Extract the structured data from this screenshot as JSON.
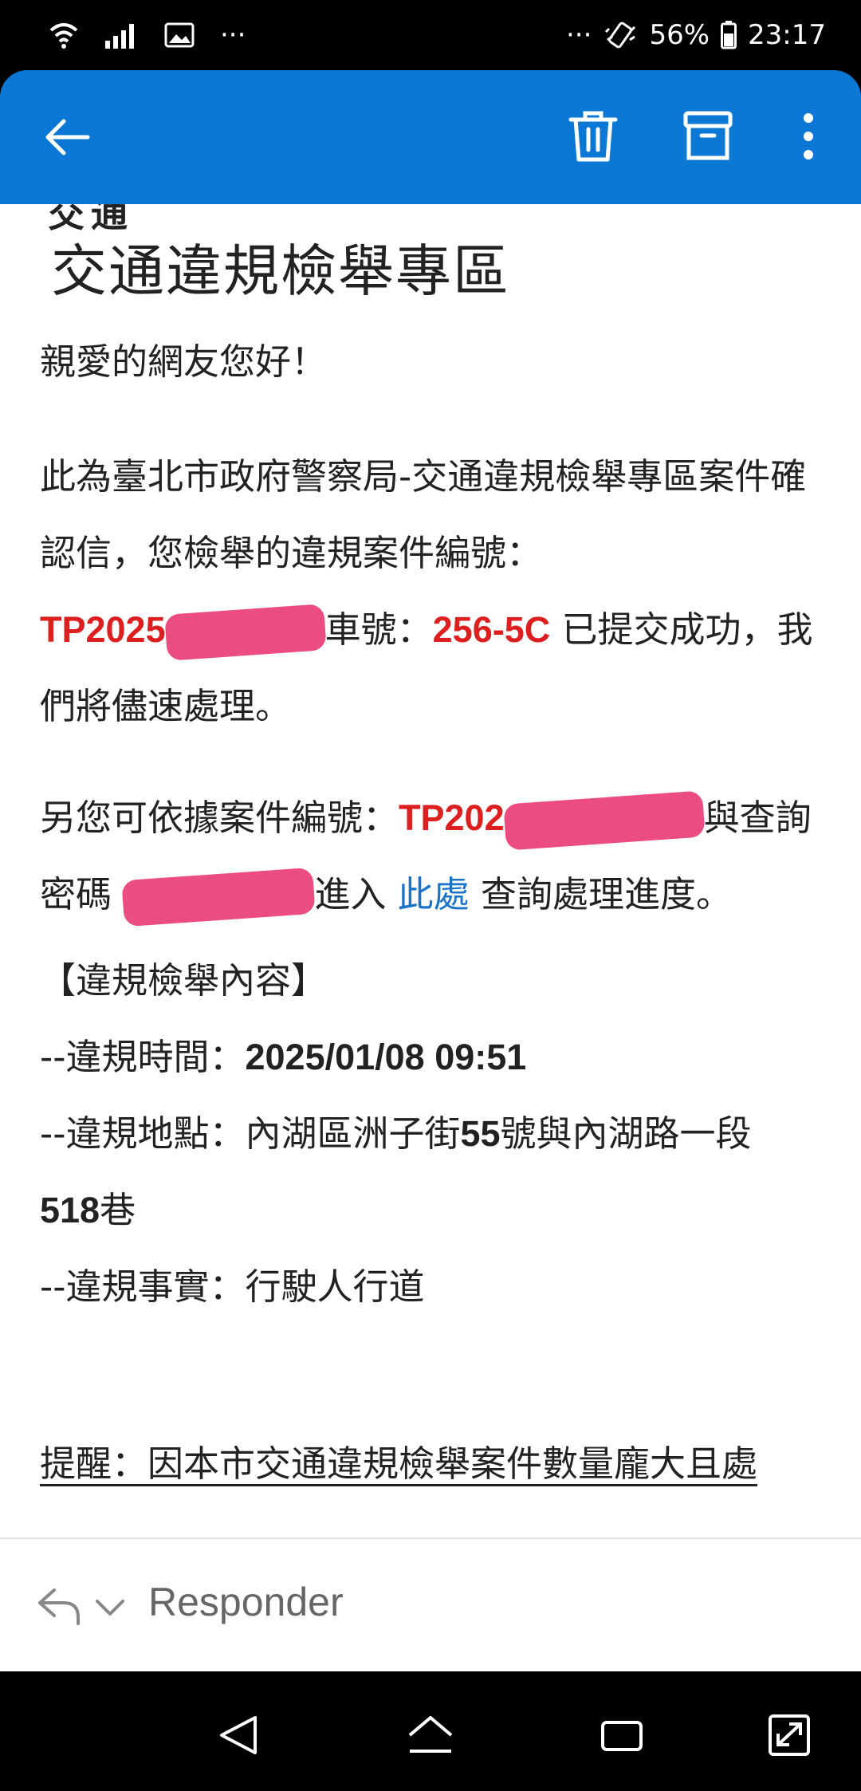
{
  "status_bar": {
    "battery": "56%",
    "time": "23:17",
    "ellipsis_left": "···",
    "ellipsis_right": "···"
  },
  "email": {
    "clipped_heading": "交通",
    "title": "交通違規檢舉專區",
    "greeting": "親愛的網友您好！",
    "para2": {
      "text1": "此為臺北市政府警察局-交通違規檢舉專區案件確認信，您檢舉的違規案件編號：",
      "case_no_prefix": "TP2025",
      "text2": "車號：",
      "plate": "256-5C",
      "text3": " 已提交成功，我們將儘速處理。",
      "text4": "另您可依據案件編號：",
      "case_no_prefix2": "TP202",
      "text5": "與查詢密碼 ",
      "text6": "進入 ",
      "link": "此處",
      "text7": " 查詢處理進度。"
    },
    "details": {
      "heading": "【違規檢舉內容】",
      "time_label": "--違規時間：",
      "time_value": "2025/01/08 09:51",
      "place_label": "--違規地點：內湖區洲子街",
      "place_num1": "55",
      "place_mid": "號與內湖路一段",
      "place_num2": "518",
      "place_end": "巷",
      "fact_label": "--違規事實：",
      "fact_value": "行駛人行道"
    },
    "reminder": "提醒：因本市交通違規檢舉案件數量龐大且處"
  },
  "reply": {
    "label": "Responder"
  },
  "colors": {
    "app_bar": "#0a78d4",
    "highlight": "#dd1f1f",
    "link": "#1a73c8",
    "redaction": "#ec4d80"
  }
}
